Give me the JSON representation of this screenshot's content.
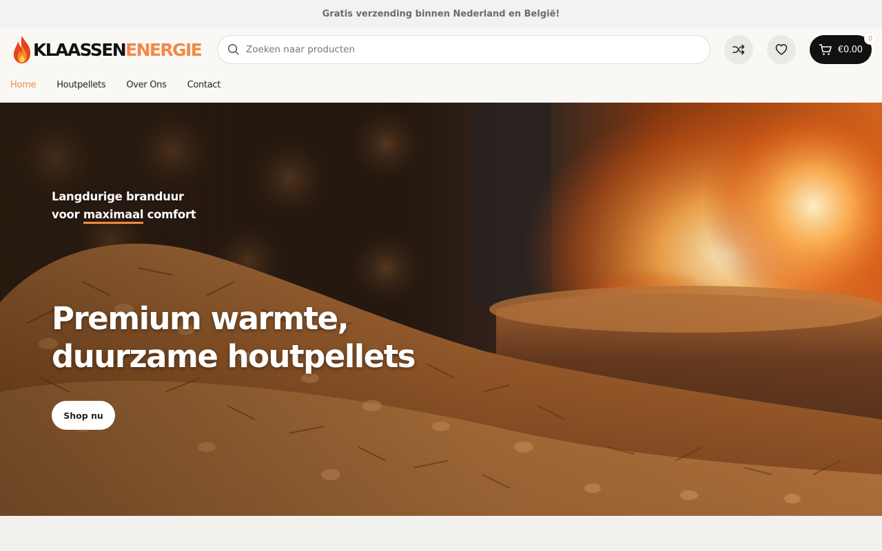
{
  "topbar": {
    "text": "Gratis verzending binnen Nederland en België!"
  },
  "brand": {
    "name_part1": "KLAASSEN",
    "name_part2": "ENERGIE",
    "accent": "#f2894a",
    "dark": "#111111"
  },
  "search": {
    "placeholder": "Zoeken naar producten",
    "icon": "search-icon"
  },
  "actions": {
    "compare_icon": "shuffle-icon",
    "wishlist_icon": "heart-icon",
    "cart": {
      "total": "€0.00",
      "count": "0",
      "icon": "cart-icon"
    }
  },
  "nav": {
    "items": [
      {
        "label": "Home",
        "active": true
      },
      {
        "label": "Houtpellets",
        "active": false
      },
      {
        "label": "Over Ons",
        "active": false
      },
      {
        "label": "Contact",
        "active": false
      }
    ]
  },
  "hero": {
    "subtitle_line1": "Langdurige branduur",
    "subtitle_line2_pre": "voor",
    "subtitle_highlight": "maximaal",
    "subtitle_line2_post": "comfort",
    "title_line1": "Premium warmte,",
    "title_line2": "duurzame houtpellets",
    "cta": "Shop nu"
  }
}
